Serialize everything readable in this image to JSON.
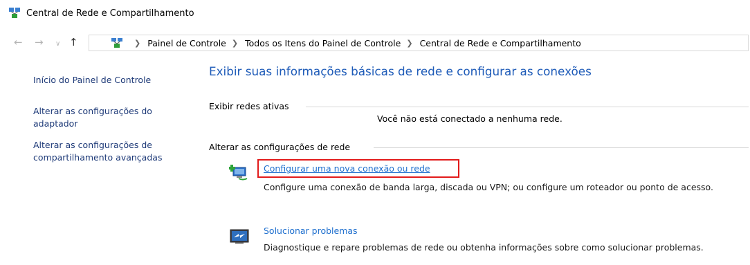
{
  "window": {
    "title": "Central de Rede e Compartilhamento"
  },
  "nav": {
    "back_icon": "back-arrow-icon",
    "forward_icon": "forward-arrow-icon",
    "up_icon": "up-arrow-icon"
  },
  "breadcrumb": [
    "Painel de Controle",
    "Todos os Itens do Painel de Controle",
    "Central de Rede e Compartilhamento"
  ],
  "left_pane": {
    "home": "Início do Painel de Controle",
    "adapter": "Alterar as configurações do adaptador",
    "sharing": "Alterar as configurações de compartilhamento avançadas"
  },
  "main": {
    "heading": "Exibir suas informações básicas de rede e configurar as conexões",
    "active_networks_label": "Exibir redes ativas",
    "no_network": "Você não está conectado a nenhuma rede.",
    "change_settings_label": "Alterar as configurações de rede",
    "tasks": [
      {
        "link": "Configurar uma nova conexão ou rede",
        "desc": "Configure uma conexão de banda larga, discada ou VPN; ou configure um roteador ou ponto de acesso.",
        "icon": "new-connection-icon"
      },
      {
        "link": "Solucionar problemas",
        "desc": "Diagnostique e repare problemas de rede ou obtenha informações sobre como solucionar problemas.",
        "icon": "troubleshoot-icon"
      }
    ]
  },
  "colors": {
    "link": "#1e6fce",
    "heading": "#1e5bb8",
    "highlight": "#e21a1a"
  }
}
